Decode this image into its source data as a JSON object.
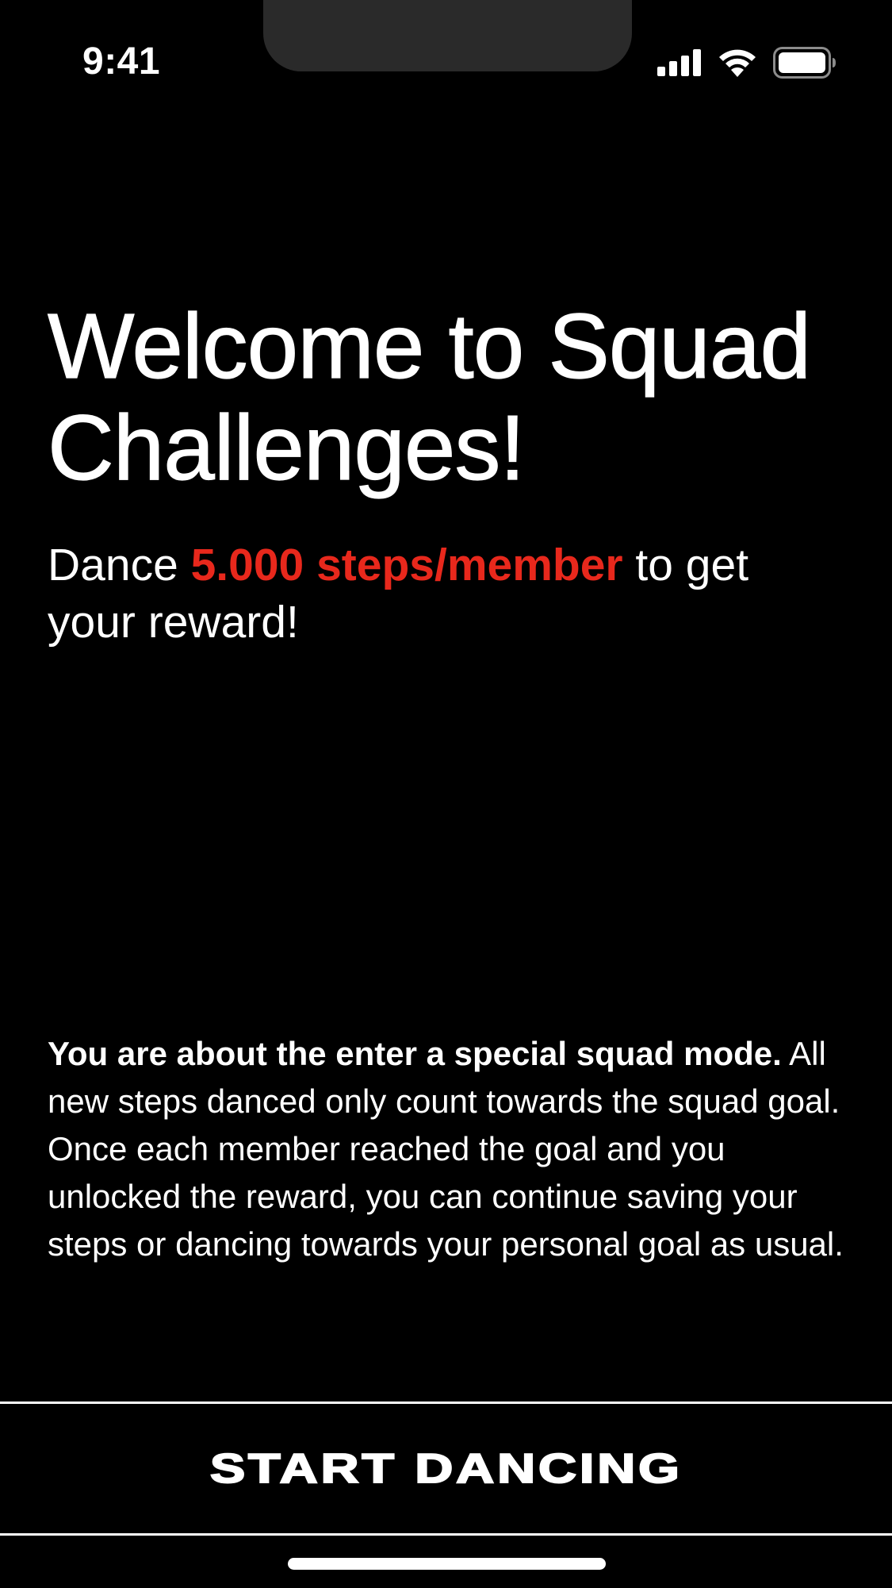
{
  "status_bar": {
    "time": "9:41",
    "icons": [
      "cellular-signal-icon",
      "wifi-icon",
      "battery-icon"
    ]
  },
  "main": {
    "headline": "Welcome to Squad Challenges!",
    "subline": {
      "prefix": "Dance ",
      "highlight": "5.000 steps/member",
      "suffix": " to get your reward!"
    },
    "info": {
      "lead": "You are about the enter a special squad mode.",
      "body": "All new steps danced only count towards the squad goal. Once each member reached the goal and you unlocked the reward, you can continue saving your steps or dancing towards your personal goal as usual."
    }
  },
  "cta": {
    "label": "START DANCING"
  },
  "colors": {
    "background": "#000000",
    "text": "#ffffff",
    "accent": "#e8281c"
  }
}
